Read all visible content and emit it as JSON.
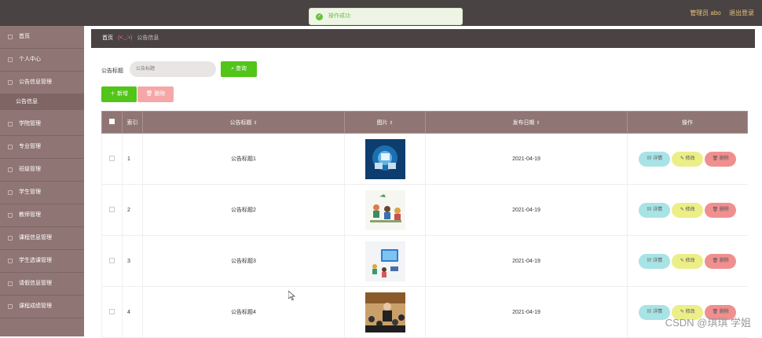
{
  "topbar": {
    "user": "管理员 abo",
    "logout": "退出登录"
  },
  "toast": {
    "message": "操作成功"
  },
  "sidebar": {
    "items": [
      {
        "label": "首页"
      },
      {
        "label": "个人中心"
      },
      {
        "label": "公告信息管理"
      },
      {
        "label": "学院管理"
      },
      {
        "label": "专业管理"
      },
      {
        "label": "班级管理"
      },
      {
        "label": "学生管理"
      },
      {
        "label": "教师管理"
      },
      {
        "label": "课程信息管理"
      },
      {
        "label": "学生选课管理"
      },
      {
        "label": "请假信息管理"
      },
      {
        "label": "课程成绩管理"
      }
    ],
    "active_sub": "公告信息"
  },
  "breadcrumb": {
    "home": "首页",
    "face": "(•'◡'•)",
    "current": "公告信息"
  },
  "search": {
    "label": "公告标题",
    "placeholder": "公告标题",
    "button": "查询"
  },
  "toolbar": {
    "add": "新增",
    "delete": "删除"
  },
  "table": {
    "headers": {
      "index": "索引",
      "title": "公告标题",
      "image": "图片",
      "date": "发布日期",
      "actions": "操作"
    },
    "rows": [
      {
        "index": "1",
        "title": "公告标题1",
        "date": "2021-04-19",
        "image": "server-network-image"
      },
      {
        "index": "2",
        "title": "公告标题2",
        "date": "2021-04-19",
        "image": "classroom-illustration-image"
      },
      {
        "index": "3",
        "title": "公告标题3",
        "date": "2021-04-19",
        "image": "online-learning-image"
      },
      {
        "index": "4",
        "title": "公告标题4",
        "date": "2021-04-19",
        "image": "lecture-photo-image"
      }
    ],
    "row_actions": {
      "detail": "详情",
      "edit": "修改",
      "delete": "删除"
    }
  },
  "watermark": "CSDN @琪琪 学姐"
}
